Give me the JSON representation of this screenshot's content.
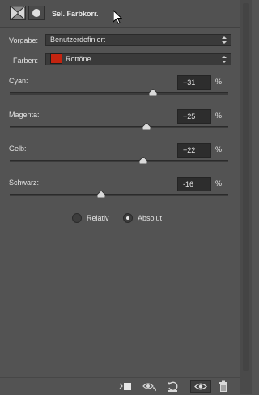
{
  "header": {
    "title": "Sel. Farbkorr.",
    "icons": [
      "adjustment-layer-icon",
      "mask-icon"
    ]
  },
  "vorgabe": {
    "label": "Vorgabe:",
    "value": "Benutzerdefiniert"
  },
  "farben": {
    "label": "Farben:",
    "value": "Rottöne",
    "swatch_color": "#c42410"
  },
  "sliders": [
    {
      "label": "Cyan:",
      "value": "+31",
      "unit": "%",
      "percent": 31
    },
    {
      "label": "Magenta:",
      "value": "+25",
      "unit": "%",
      "percent": 25
    },
    {
      "label": "Gelb:",
      "value": "+22",
      "unit": "%",
      "percent": 22
    },
    {
      "label": "Schwarz:",
      "value": "-16",
      "unit": "%",
      "percent": -16
    }
  ],
  "method": {
    "options": [
      {
        "label": "Relativ",
        "selected": false
      },
      {
        "label": "Absolut",
        "selected": true
      }
    ]
  },
  "bottom_bar": {
    "buttons": [
      "clip-to-layer-icon",
      "view-previous-state-icon",
      "reset-icon",
      "visibility-eye-icon",
      "delete-trash-icon"
    ]
  }
}
